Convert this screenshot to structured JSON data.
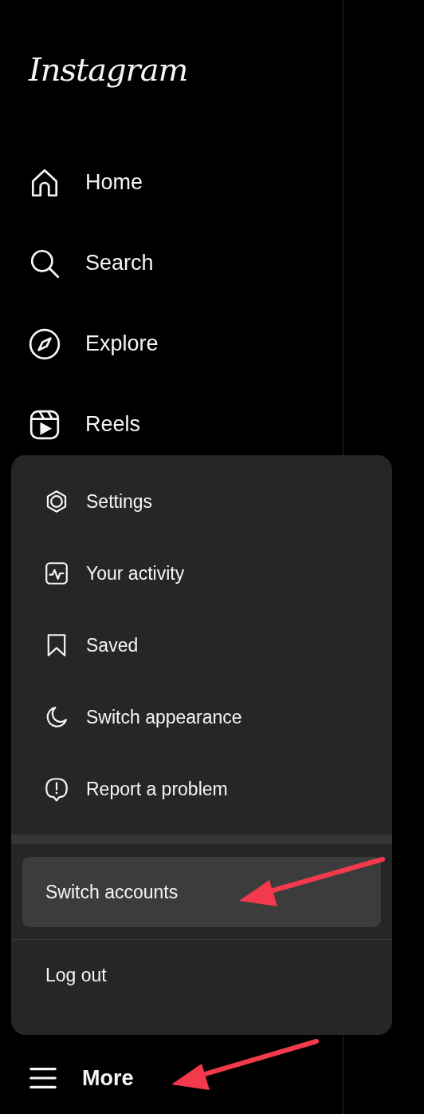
{
  "logo": "Instagram",
  "nav": [
    {
      "label": "Home",
      "kind": "home"
    },
    {
      "label": "Search",
      "kind": "search"
    },
    {
      "label": "Explore",
      "kind": "compass"
    },
    {
      "label": "Reels",
      "kind": "reels"
    }
  ],
  "menu": {
    "items": [
      {
        "label": "Settings",
        "kind": "settings"
      },
      {
        "label": "Your activity",
        "kind": "activity"
      },
      {
        "label": "Saved",
        "kind": "bookmark"
      },
      {
        "label": "Switch appearance",
        "kind": "moon"
      },
      {
        "label": "Report a problem",
        "kind": "report"
      }
    ],
    "account_actions": [
      {
        "label": "Switch accounts",
        "selected": true
      },
      {
        "label": "Log out",
        "selected": false
      }
    ]
  },
  "more": {
    "label": "More",
    "kind": "menu"
  }
}
